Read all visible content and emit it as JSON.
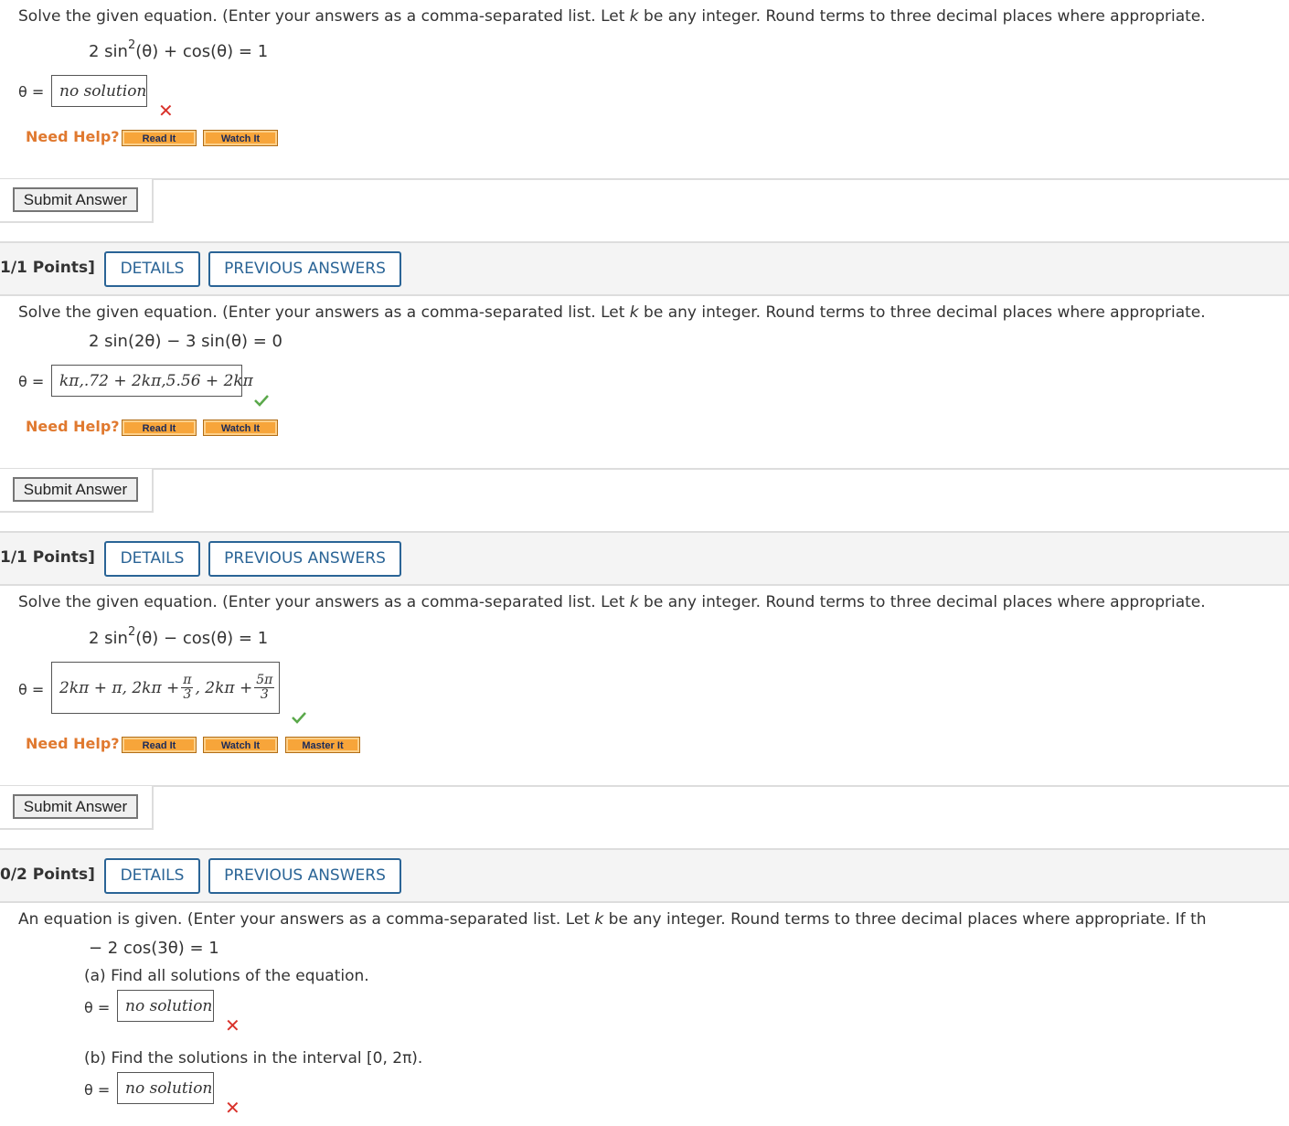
{
  "questions": [
    {
      "prompt_pre": "Solve the given equation. (Enter your answers as a comma-separated list. Let ",
      "prompt_k": "k",
      "prompt_post": " be any integer. Round terms to three decimal places where appropriate.",
      "equation_left": "2 sin",
      "equation_exp": "2",
      "equation_right": "(θ) + cos(θ) = 1",
      "theta_label": "θ =",
      "answer": "no solution",
      "result": "incorrect",
      "need_help": "Need Help?",
      "help_buttons": [
        "Read It",
        "Watch It"
      ],
      "submit_label": "Submit Answer"
    },
    {
      "points": "1/1 Points]",
      "details_label": "DETAILS",
      "previous_answers_label": "PREVIOUS ANSWERS",
      "prompt_pre": "Solve the given equation. (Enter your answers as a comma-separated list. Let ",
      "prompt_k": "k",
      "prompt_post": " be any integer. Round terms to three decimal places where appropriate.",
      "equation": "2 sin(2θ) − 3 sin(θ) = 0",
      "theta_label": "θ =",
      "answer": "kπ,.72 + 2kπ,5.56 + 2kπ",
      "result": "correct",
      "need_help": "Need Help?",
      "help_buttons": [
        "Read It",
        "Watch It"
      ],
      "submit_label": "Submit Answer"
    },
    {
      "points": "1/1 Points]",
      "details_label": "DETAILS",
      "previous_answers_label": "PREVIOUS ANSWERS",
      "prompt_pre": "Solve the given equation. (Enter your answers as a comma-separated list. Let ",
      "prompt_k": "k",
      "prompt_post": " be any integer. Round terms to three decimal places where appropriate.",
      "equation_left": "2 sin",
      "equation_exp": "2",
      "equation_right": "(θ) − cos(θ) = 1",
      "theta_label": "θ =",
      "answer_part1": "2kπ + π, 2kπ +",
      "answer_frac1_num": "π",
      "answer_frac1_den": "3",
      "answer_part2": ", 2kπ +",
      "answer_frac2_num": "5π",
      "answer_frac2_den": "3",
      "result": "correct",
      "need_help": "Need Help?",
      "help_buttons": [
        "Read It",
        "Watch It",
        "Master It"
      ],
      "submit_label": "Submit Answer"
    },
    {
      "points": "0/2 Points]",
      "details_label": "DETAILS",
      "previous_answers_label": "PREVIOUS ANSWERS",
      "prompt_pre": "An equation is given. (Enter your answers as a comma-separated list. Let ",
      "prompt_k": "k",
      "prompt_post": " be any integer. Round terms to three decimal places where appropriate. If th",
      "equation": "− 2 cos(3θ) = 1",
      "part_a_label": "(a) Find all solutions of the equation.",
      "part_a_theta": "θ =",
      "part_a_answer": "no solution",
      "part_a_result": "incorrect",
      "part_b_label": "(b) Find the solutions in the interval [0, 2π).",
      "part_b_theta": "θ =",
      "part_b_answer": "no solution",
      "part_b_result": "incorrect"
    }
  ],
  "colors": {
    "link_blue": "#2a6496",
    "need_help_orange": "#e0792f",
    "help_button": "#f7a53a",
    "incorrect_red": "#d9322b",
    "correct_green": "#5aa84a"
  },
  "icons": {
    "incorrect": "x-mark-icon",
    "correct": "check-mark-icon"
  }
}
